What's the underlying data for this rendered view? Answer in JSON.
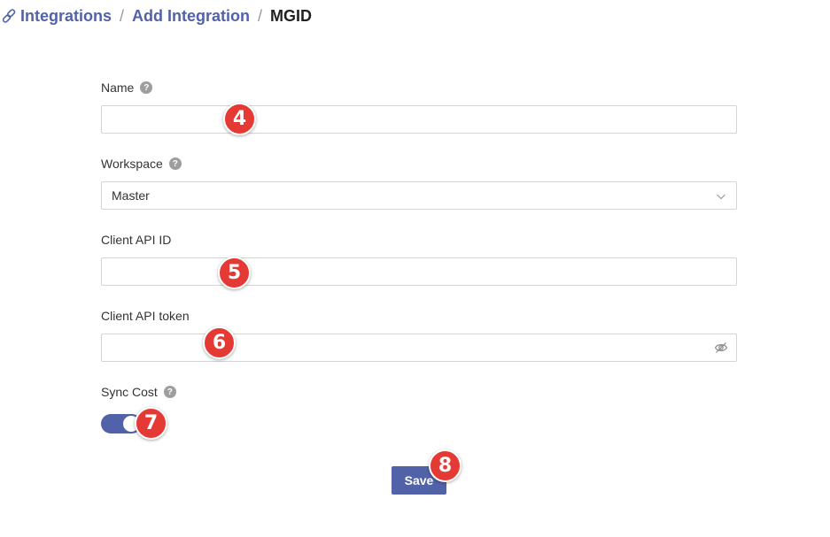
{
  "breadcrumb": {
    "icon": "link-icon",
    "items": [
      "Integrations",
      "Add Integration",
      "MGID"
    ],
    "separator": "/"
  },
  "form": {
    "name": {
      "label": "Name",
      "value": "",
      "help_icon": "question-icon"
    },
    "workspace": {
      "label": "Workspace",
      "value": "Master",
      "help_icon": "question-icon",
      "dropdown_icon": "chevron-down-icon"
    },
    "client_api_id": {
      "label": "Client API ID",
      "value": ""
    },
    "client_api_token": {
      "label": "Client API token",
      "value": "",
      "visibility_icon": "eye-off-icon"
    },
    "sync_cost": {
      "label": "Sync Cost",
      "enabled": true,
      "help_icon": "question-icon"
    },
    "save_label": "Save"
  },
  "markers": [
    "4",
    "5",
    "6",
    "7",
    "8"
  ],
  "colors": {
    "accent": "#5262a8",
    "marker": "#e53935",
    "border": "#d4d4d4",
    "help": "#9e9e9e"
  }
}
